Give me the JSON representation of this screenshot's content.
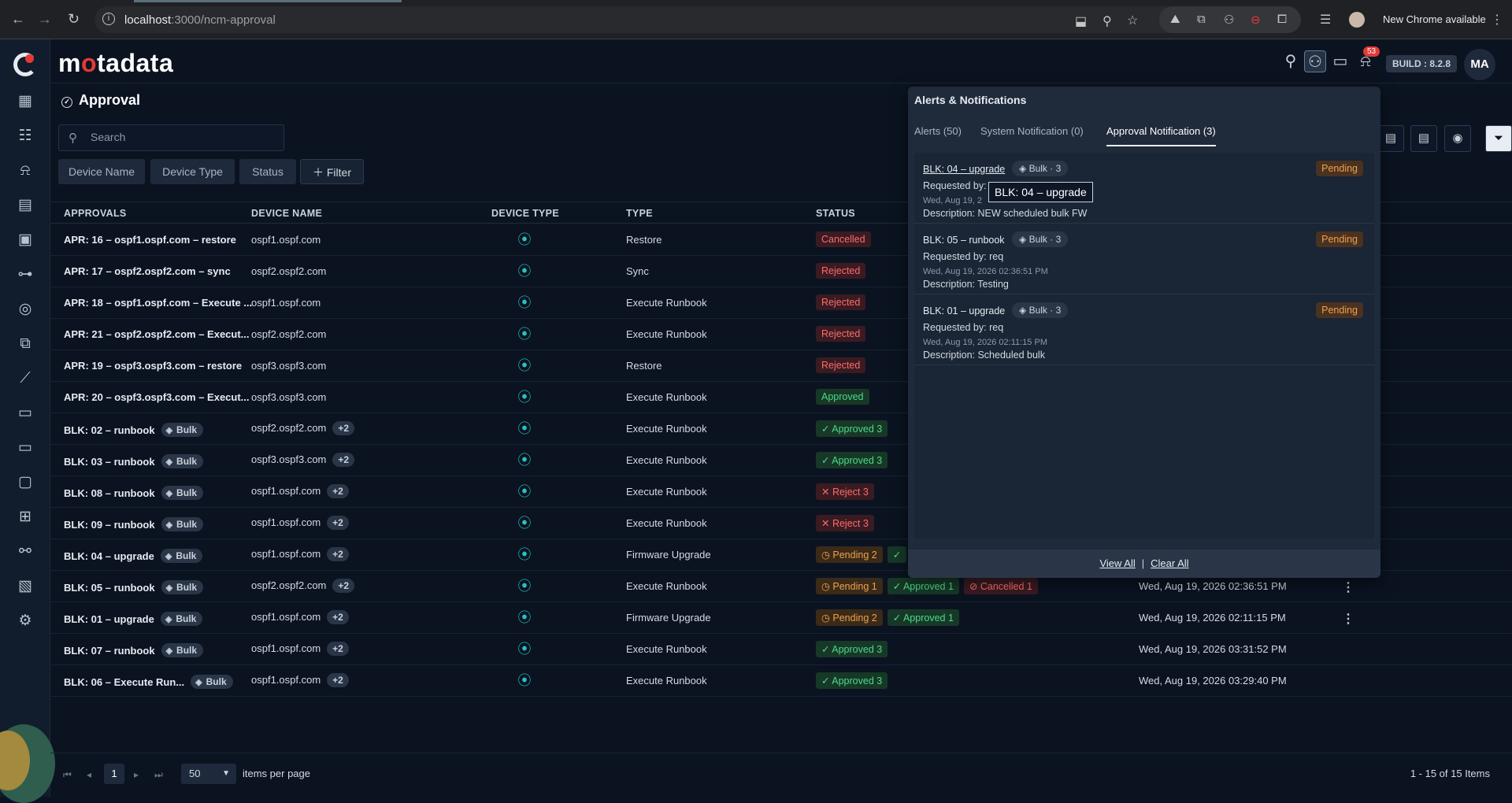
{
  "browser": {
    "url_host": "localhost",
    "url_path": ":3000/ncm-approval",
    "new_chrome": "New Chrome available"
  },
  "app": {
    "brand_prefix": "m",
    "brand_o": "o",
    "brand_suffix": "tadata",
    "notification_count": "53",
    "build": "BUILD : 8.2.8",
    "avatar": "MA"
  },
  "page": {
    "title": "Approval",
    "search_placeholder": "Search",
    "chips": [
      "Device Name",
      "Device Type",
      "Status"
    ],
    "filter_label": "Filter"
  },
  "table": {
    "headers": [
      "APPROVALS",
      "DEVICE NAME",
      "DEVICE TYPE",
      "TYPE",
      "STATUS"
    ],
    "rows": [
      {
        "name": "APR: 16 – ospf1.ospf.com – restore",
        "bulk": "",
        "device": "ospf1.ospf.com",
        "plus": "",
        "type": "Restore",
        "status": [
          {
            "t": "Cancelled",
            "c": "red",
            "i": ""
          }
        ],
        "date": "",
        "kebab": false
      },
      {
        "name": "APR: 17 – ospf2.ospf2.com – sync",
        "bulk": "",
        "device": "ospf2.ospf2.com",
        "plus": "",
        "type": "Sync",
        "status": [
          {
            "t": "Rejected",
            "c": "red",
            "i": ""
          }
        ],
        "date": "",
        "kebab": false
      },
      {
        "name": "APR: 18 – ospf1.ospf.com – Execute ...",
        "bulk": "",
        "device": "ospf1.ospf.com",
        "plus": "",
        "type": "Execute Runbook",
        "status": [
          {
            "t": "Rejected",
            "c": "red",
            "i": ""
          }
        ],
        "date": "",
        "kebab": false
      },
      {
        "name": "APR: 21 – ospf2.ospf2.com – Execut...",
        "bulk": "",
        "device": "ospf2.ospf2.com",
        "plus": "",
        "type": "Execute Runbook",
        "status": [
          {
            "t": "Rejected",
            "c": "red",
            "i": ""
          }
        ],
        "date": "",
        "kebab": false
      },
      {
        "name": "APR: 19 – ospf3.ospf3.com – restore",
        "bulk": "",
        "device": "ospf3.ospf3.com",
        "plus": "",
        "type": "Restore",
        "status": [
          {
            "t": "Rejected",
            "c": "red",
            "i": ""
          }
        ],
        "date": "",
        "kebab": false
      },
      {
        "name": "APR: 20 – ospf3.ospf3.com – Execut...",
        "bulk": "",
        "device": "ospf3.ospf3.com",
        "plus": "",
        "type": "Execute Runbook",
        "status": [
          {
            "t": "Approved",
            "c": "green",
            "i": ""
          }
        ],
        "date": "",
        "kebab": false
      },
      {
        "name": "BLK: 02 – runbook",
        "bulk": "Bulk",
        "device": "ospf2.ospf2.com",
        "plus": "+2",
        "type": "Execute Runbook",
        "status": [
          {
            "t": "Approved 3",
            "c": "green",
            "i": "✓"
          }
        ],
        "date": "",
        "kebab": false
      },
      {
        "name": "BLK: 03 – runbook",
        "bulk": "Bulk",
        "device": "ospf3.ospf3.com",
        "plus": "+2",
        "type": "Execute Runbook",
        "status": [
          {
            "t": "Approved 3",
            "c": "green",
            "i": "✓"
          }
        ],
        "date": "",
        "kebab": false
      },
      {
        "name": "BLK: 08 – runbook",
        "bulk": "Bulk",
        "device": "ospf1.ospf.com",
        "plus": "+2",
        "type": "Execute Runbook",
        "status": [
          {
            "t": "Reject 3",
            "c": "red",
            "i": "✕"
          }
        ],
        "date": "",
        "kebab": false
      },
      {
        "name": "BLK: 09 – runbook",
        "bulk": "Bulk",
        "device": "ospf1.ospf.com",
        "plus": "+2",
        "type": "Execute Runbook",
        "status": [
          {
            "t": "Reject 3",
            "c": "red",
            "i": "✕"
          }
        ],
        "date": "",
        "kebab": false
      },
      {
        "name": "BLK: 04 – upgrade",
        "bulk": "Bulk",
        "device": "ospf1.ospf.com",
        "plus": "+2",
        "type": "Firmware Upgrade",
        "status": [
          {
            "t": "Pending 2",
            "c": "amber",
            "i": "◷"
          },
          {
            "t": "",
            "c": "green",
            "i": "✓"
          }
        ],
        "date": "",
        "kebab": false
      },
      {
        "name": "BLK: 05 – runbook",
        "bulk": "Bulk",
        "device": "ospf2.ospf2.com",
        "plus": "+2",
        "type": "Execute Runbook",
        "status": [
          {
            "t": "Pending 1",
            "c": "amber",
            "i": "◷"
          },
          {
            "t": "Approved 1",
            "c": "green",
            "i": "✓"
          },
          {
            "t": "Cancelled 1",
            "c": "red",
            "i": "⊘"
          }
        ],
        "date": "Wed, Aug 19, 2026 02:36:51 PM",
        "kebab": true
      },
      {
        "name": "BLK: 01 – upgrade",
        "bulk": "Bulk",
        "device": "ospf1.ospf.com",
        "plus": "+2",
        "type": "Firmware Upgrade",
        "status": [
          {
            "t": "Pending 2",
            "c": "amber",
            "i": "◷"
          },
          {
            "t": "Approved 1",
            "c": "green",
            "i": "✓"
          }
        ],
        "date": "Wed, Aug 19, 2026 02:11:15 PM",
        "kebab": true
      },
      {
        "name": "BLK: 07 – runbook",
        "bulk": "Bulk",
        "device": "ospf1.ospf.com",
        "plus": "+2",
        "type": "Execute Runbook",
        "status": [
          {
            "t": "Approved 3",
            "c": "green",
            "i": "✓"
          }
        ],
        "date": "Wed, Aug 19, 2026 03:31:52 PM",
        "kebab": false
      },
      {
        "name": "BLK: 06 – Execute Run...",
        "bulk": "Bulk",
        "device": "ospf1.ospf.com",
        "plus": "+2",
        "type": "Execute Runbook",
        "status": [
          {
            "t": "Approved 3",
            "c": "green",
            "i": "✓"
          }
        ],
        "date": "Wed, Aug 19, 2026 03:29:40 PM",
        "kebab": false
      }
    ]
  },
  "pagination": {
    "page": "1",
    "per_page": "50",
    "items_label": "items per page",
    "count": "1 - 15 of 15 Items"
  },
  "panel": {
    "title": "Alerts & Notifications",
    "tabs": [
      "Alerts (50)",
      "System Notification (0)",
      "Approval Notification (3)"
    ],
    "items": [
      {
        "title": "BLK: 04 – upgrade",
        "bulk": "Bulk · 3",
        "status": "Pending",
        "requested": "Requested by:",
        "date": "Wed, Aug 19, 2",
        "desc": "Description: NEW scheduled bulk FW"
      },
      {
        "title": "BLK: 05 – runbook",
        "bulk": "Bulk · 3",
        "status": "Pending",
        "requested": "Requested by: req",
        "date": "Wed, Aug 19, 2026 02:36:51 PM",
        "desc": "Description: Testing"
      },
      {
        "title": "BLK: 01 – upgrade",
        "bulk": "Bulk · 3",
        "status": "Pending",
        "requested": "Requested by: req",
        "date": "Wed, Aug 19, 2026 02:11:15 PM",
        "desc": "Description: Scheduled bulk"
      }
    ],
    "tooltip": "BLK: 04 – upgrade",
    "view_all": "View All",
    "clear_all": "Clear All"
  },
  "colors": {
    "accent_red": "#e53935",
    "device_icon": "#28c2c2",
    "approved": "#4cd98a",
    "rejected": "#ff6b6b",
    "pending": "#f0a050"
  }
}
